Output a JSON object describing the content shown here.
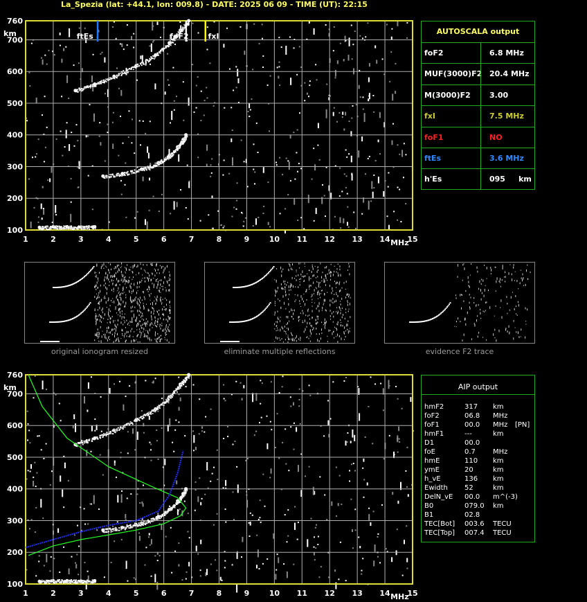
{
  "header": {
    "title": "La_Spezia (lat: +44.1, lon: 009.8) - DATE: 2025 06 09 - TIME (UT): 22:15"
  },
  "colors": {
    "axis": "#dddd33",
    "grid": "#b0b0b0",
    "fxl": "#ffff00",
    "ftEs": "#2277ff",
    "foF1": "#ff2222",
    "panel_border": "#22aa22",
    "profile_green": "#22ff22",
    "profile_blue": "#2233ff"
  },
  "top_chart": {
    "y_unit": "km",
    "x_unit": "MHz",
    "marker_labels": {
      "ftEs": "ftEs",
      "foF2": "foF2",
      "fxI": "fxI"
    }
  },
  "bottom_chart": {
    "y_unit": "km",
    "x_unit": "MHz"
  },
  "thumbnails": [
    {
      "caption": "original ionogram resized"
    },
    {
      "caption": "eliminate multiple reflections"
    },
    {
      "caption": "evidence F2 trace"
    }
  ],
  "autoscala": {
    "title": "AUTOSCALA output",
    "rows": [
      {
        "label": "foF2",
        "value": "6.8 MHz",
        "color": "#ffffff"
      },
      {
        "label": "MUF(3000)F2",
        "value": "20.4 MHz",
        "color": "#ffffff"
      },
      {
        "label": "M(3000)F2",
        "value": "3.00",
        "color": "#ffffff"
      },
      {
        "label": "fxI",
        "value": "7.5 MHz",
        "color": "#cccc33"
      },
      {
        "label": "foF1",
        "value": "NO",
        "color": "#ff2222"
      },
      {
        "label": "ftEs",
        "value": "3.6 MHz",
        "color": "#3388ff"
      },
      {
        "label": "h'Es",
        "value": "095     km",
        "color": "#ffffff"
      }
    ]
  },
  "aip": {
    "title": "AIP output",
    "rows": [
      {
        "name": "hmF2",
        "value": "317",
        "unit": "km",
        "extra": ""
      },
      {
        "name": "foF2",
        "value": "06.8",
        "unit": "MHz",
        "extra": ""
      },
      {
        "name": "foF1",
        "value": "00.0",
        "unit": "MHz",
        "extra": "[PN]"
      },
      {
        "name": "hmF1",
        "value": "---",
        "unit": "km",
        "extra": ""
      },
      {
        "name": "D1",
        "value": "00.0",
        "unit": "",
        "extra": ""
      },
      {
        "name": "foE",
        "value": "0.7",
        "unit": "MHz",
        "extra": ""
      },
      {
        "name": "hmE",
        "value": "110",
        "unit": "km",
        "extra": ""
      },
      {
        "name": "ymE",
        "value": "20",
        "unit": "km",
        "extra": ""
      },
      {
        "name": "h_vE",
        "value": "136",
        "unit": "km",
        "extra": ""
      },
      {
        "name": "Ewidth",
        "value": "52",
        "unit": "km",
        "extra": ""
      },
      {
        "name": "DelN_vE",
        "value": "00.0",
        "unit": "m^(-3)",
        "extra": ""
      },
      {
        "name": "B0",
        "value": "079.0",
        "unit": "km",
        "extra": ""
      },
      {
        "name": "B1",
        "value": "02.8",
        "unit": "",
        "extra": ""
      },
      {
        "name": "TEC[Bot]",
        "value": "003.6",
        "unit": "TECU",
        "extra": ""
      },
      {
        "name": "TEC[Top]",
        "value": "007.4",
        "unit": "TECU",
        "extra": ""
      }
    ]
  },
  "chart_data": [
    {
      "type": "scatter",
      "title": "",
      "xlabel": "MHz",
      "ylabel": "km",
      "xlim": [
        1,
        15
      ],
      "ylim": [
        100,
        760
      ],
      "x_ticks": [
        1,
        2,
        3,
        4,
        5,
        6,
        7,
        8,
        9,
        10,
        11,
        12,
        13,
        14,
        15
      ],
      "y_ticks": [
        100,
        200,
        300,
        400,
        500,
        600,
        700,
        760
      ],
      "grid": true,
      "markers": [
        {
          "name": "ftEs",
          "x": 3.6
        },
        {
          "name": "foF2",
          "x": 6.8
        },
        {
          "name": "fxI",
          "x": 7.5
        }
      ],
      "series": [
        {
          "name": "F2 trace (o)",
          "x": [
            3.8,
            4.5,
            5.2,
            5.8,
            6.2,
            6.5,
            6.7,
            6.8
          ],
          "y": [
            270,
            278,
            292,
            312,
            335,
            362,
            385,
            400
          ]
        },
        {
          "name": "F2 multiple",
          "x": [
            2.8,
            3.5,
            4.2,
            5.0,
            5.7,
            6.2,
            6.6,
            6.9
          ],
          "y": [
            540,
            560,
            585,
            618,
            652,
            690,
            730,
            760
          ]
        },
        {
          "name": "Es trace",
          "x": [
            1.5,
            2.0,
            2.5,
            3.0,
            3.5
          ],
          "y": [
            108,
            110,
            110,
            109,
            110
          ]
        }
      ]
    },
    {
      "type": "scatter",
      "title": "",
      "xlabel": "MHz",
      "ylabel": "km",
      "xlim": [
        1,
        15
      ],
      "ylim": [
        100,
        760
      ],
      "x_ticks": [
        1,
        2,
        3,
        4,
        5,
        6,
        7,
        8,
        9,
        10,
        11,
        12,
        13,
        14,
        15
      ],
      "y_ticks": [
        100,
        200,
        300,
        400,
        500,
        600,
        700,
        760
      ],
      "grid": true,
      "series": [
        {
          "name": "F2 trace (o)",
          "x": [
            3.8,
            4.5,
            5.2,
            5.8,
            6.2,
            6.5,
            6.7,
            6.8
          ],
          "y": [
            270,
            278,
            292,
            312,
            335,
            362,
            385,
            400
          ]
        },
        {
          "name": "F2 multiple",
          "x": [
            2.8,
            3.5,
            4.2,
            5.0,
            5.7,
            6.2,
            6.6,
            6.9
          ],
          "y": [
            540,
            560,
            585,
            618,
            652,
            690,
            730,
            760
          ]
        },
        {
          "name": "Es trace",
          "x": [
            1.5,
            2.0,
            2.5,
            3.0,
            3.5
          ],
          "y": [
            108,
            110,
            110,
            109,
            110
          ]
        },
        {
          "name": "electron density profile",
          "x": [
            1.1,
            2.0,
            3.0,
            4.0,
            5.0,
            6.0,
            6.6,
            6.8,
            6.5,
            5.5,
            4.0,
            2.5,
            1.6,
            1.1
          ],
          "y": [
            190,
            220,
            240,
            255,
            270,
            290,
            315,
            340,
            372,
            410,
            470,
            560,
            660,
            760
          ]
        },
        {
          "name": "modelled virtual height",
          "x": [
            1.0,
            2.0,
            3.0,
            4.0,
            5.0,
            5.8,
            6.2,
            6.5,
            6.7
          ],
          "y": [
            215,
            240,
            265,
            285,
            300,
            330,
            380,
            450,
            520
          ]
        }
      ]
    }
  ]
}
